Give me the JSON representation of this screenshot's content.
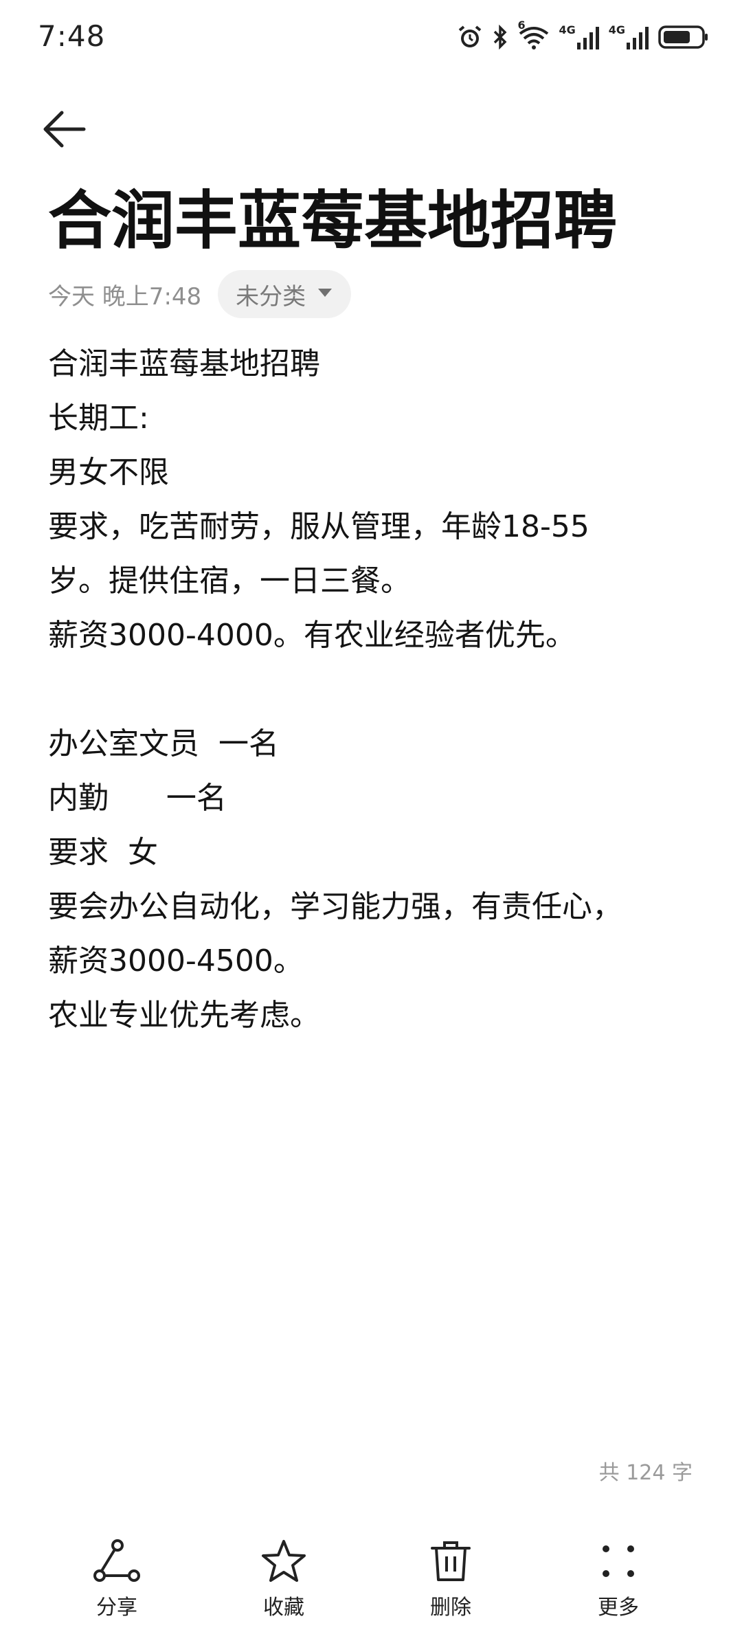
{
  "status_bar": {
    "time": "7:48",
    "icons": [
      "alarm-icon",
      "bluetooth-icon",
      "wifi-icon",
      "signal-4g-icon",
      "signal-4g-icon",
      "battery-icon"
    ],
    "wifi_badge": "6",
    "net_label_1": "4G",
    "net_label_2": "4G"
  },
  "header": {
    "back_icon": "arrow-left-icon",
    "title": "合润丰蓝莓基地招聘"
  },
  "meta": {
    "date": "今天 晚上7:48",
    "category": "未分类",
    "category_icon": "caret-down-icon"
  },
  "note": {
    "lines": [
      "合润丰蓝莓基地招聘",
      "长期工:",
      "男女不限",
      "要求，吃苦耐劳，服从管理，年龄18-55",
      "岁。提供住宿，一日三餐。",
      "薪资3000-4000。有农业经验者优先。",
      "",
      "办公室文员  一名",
      "内勤      一名",
      "要求  女",
      "要会办公自动化，学习能力强，有责任心，",
      "薪资3000-4500。",
      "农业专业优先考虑。"
    ]
  },
  "footer": {
    "word_count": "共 124 字"
  },
  "toolbar": {
    "share_label": "分享",
    "favorite_label": "收藏",
    "delete_label": "删除",
    "more_label": "更多"
  },
  "colors": {
    "text": "#111111",
    "muted": "#8f8f8f",
    "chip_bg": "#f1f1f1"
  }
}
